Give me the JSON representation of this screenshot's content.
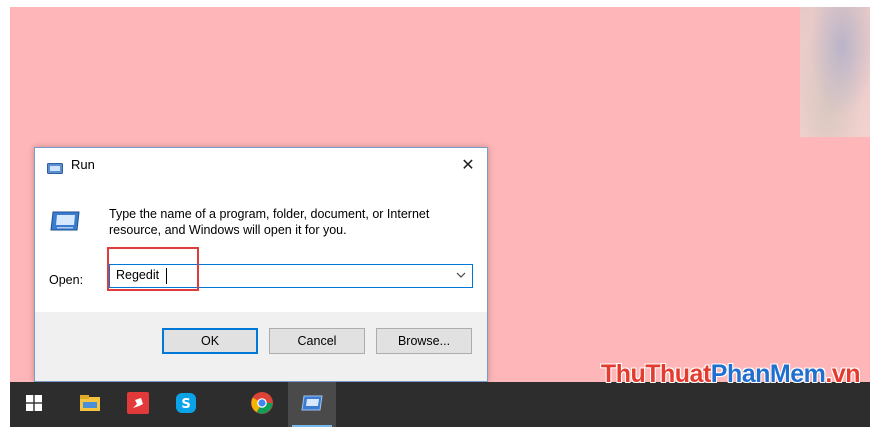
{
  "dialog": {
    "title": "Run",
    "description": "Type the name of a program, folder, document, or Internet resource, and Windows will open it for you.",
    "open_label": "Open:",
    "open_value": "Regedit",
    "buttons": {
      "ok": "OK",
      "cancel": "Cancel",
      "browse": "Browse..."
    },
    "highlight_color": "#e03c3c"
  },
  "taskbar": {
    "icons": [
      "windows-start-icon",
      "file-explorer-icon",
      "pin-app-icon",
      "skype-icon",
      "chrome-icon",
      "run-icon"
    ]
  },
  "watermark": {
    "part1": "ThuThuat",
    "part2": "PhanMem",
    "part3": ".vn"
  },
  "colors": {
    "desktop": "#ffb6b9",
    "taskbar": "#2d2d2d",
    "accent": "#0078d7"
  }
}
